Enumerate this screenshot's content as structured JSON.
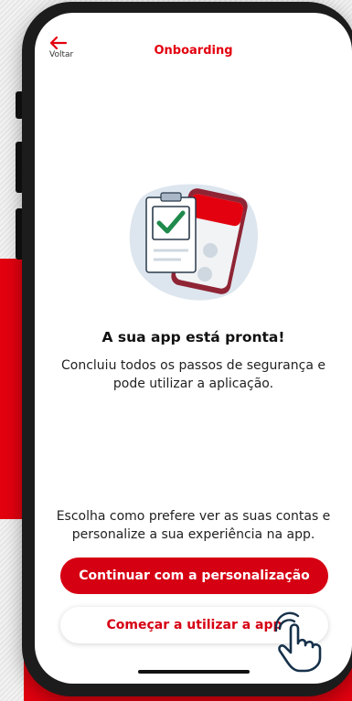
{
  "header": {
    "back_label": "Voltar",
    "title": "Onboarding"
  },
  "content": {
    "headline": "A sua app está pronta!",
    "description": "Concluiu todos os passos de segurança e pode utilizar a aplicação.",
    "note": "Escolha como prefere ver as suas contas e personalize a sua experiência na app."
  },
  "actions": {
    "primary_label": "Continuar com a personalização",
    "secondary_label": "Começar a utilizar a app"
  },
  "icons": {
    "back": "arrow-left-icon",
    "illustration": "checklist-phone-illustration",
    "pointer": "hand-pointer-icon"
  },
  "colors": {
    "brand_red": "#e3000f",
    "button_red": "#d60013",
    "check_green": "#1f8a4c"
  }
}
